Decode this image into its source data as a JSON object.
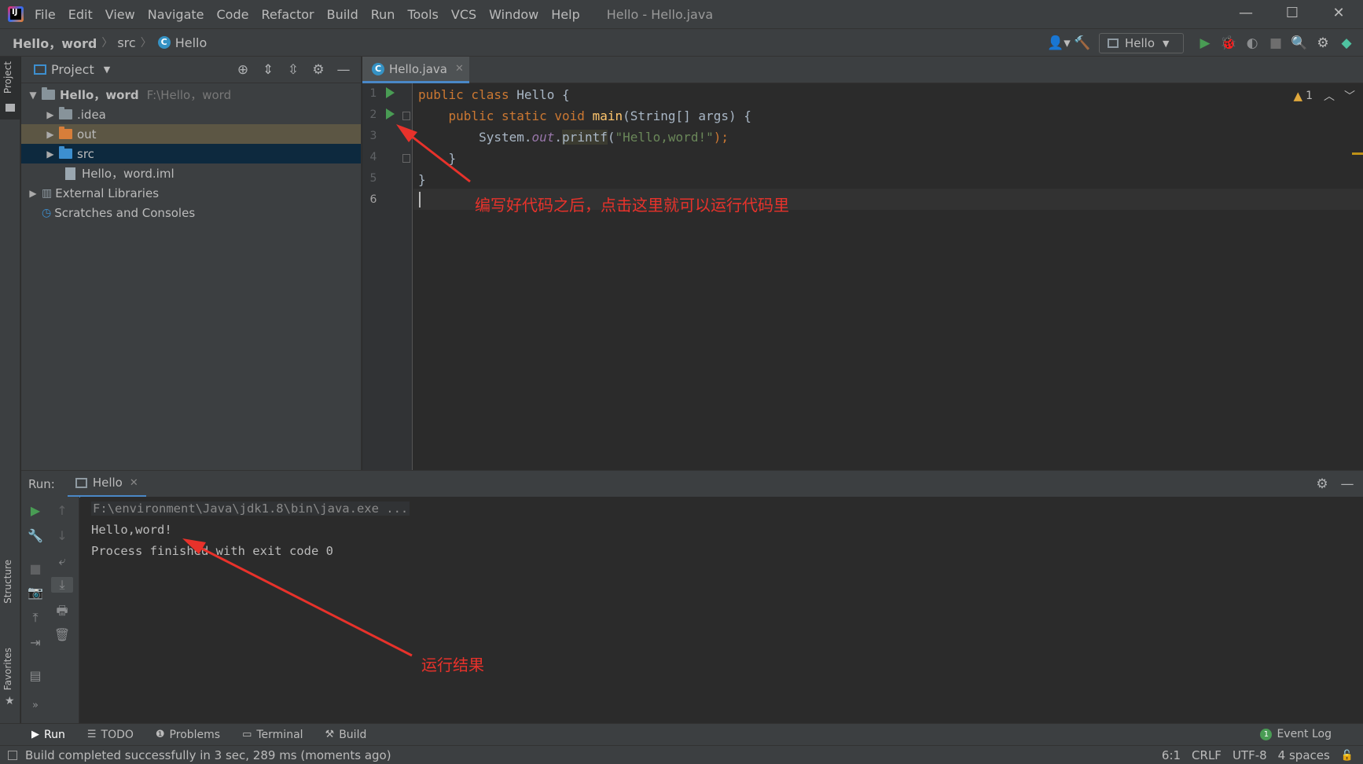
{
  "menubar": {
    "logo_text": "IJ",
    "items": [
      "File",
      "Edit",
      "View",
      "Navigate",
      "Code",
      "Refactor",
      "Build",
      "Run",
      "Tools",
      "VCS",
      "Window",
      "Help"
    ],
    "window_title": "Hello - Hello.java"
  },
  "window_controls": {
    "minimize": "—",
    "maximize": "☐",
    "close": "✕"
  },
  "navbar": {
    "breadcrumbs": [
      "Hello，word",
      "src",
      "Hello"
    ],
    "run_config": "Hello"
  },
  "left_strip": {
    "project_tab": "Project",
    "structure_tab": "Structure",
    "favorites_tab": "Favorites"
  },
  "project_panel": {
    "title": "Project",
    "tree": [
      {
        "label": "Hello，word",
        "path": "F:\\Hello，word"
      },
      {
        "label": ".idea"
      },
      {
        "label": "out"
      },
      {
        "label": "src"
      },
      {
        "label": "Hello，word.iml"
      },
      {
        "label": "External Libraries"
      },
      {
        "label": "Scratches and Consoles"
      }
    ]
  },
  "editor": {
    "tab_label": "Hello.java",
    "line_numbers": [
      "1",
      "2",
      "3",
      "4",
      "5",
      "6"
    ],
    "code": {
      "l1_kw": "public class ",
      "l1_rest": "Hello {",
      "l2_indent": "    ",
      "l2_kw": "public static void ",
      "l2_fn": "main",
      "l2_rest": "(String[] args) {",
      "l3_pre": "        System.",
      "l3_field": "out",
      "l3_dot": ".",
      "l3_method": "printf",
      "l3_open": "(",
      "l3_str": "\"Hello,word!\"",
      "l3_close": ");",
      "l4": "    }",
      "l5": "}"
    },
    "warning_count": "1",
    "annotation": "编写好代码之后，点击这里就可以运行代码里"
  },
  "run_panel": {
    "label": "Run:",
    "tab_label": "Hello",
    "console": [
      "F:\\environment\\Java\\jdk1.8\\bin\\java.exe ...",
      "Hello,word!",
      "Process finished with exit code 0"
    ],
    "annotation": "运行结果"
  },
  "bottom_tabs": [
    "Run",
    "TODO",
    "Problems",
    "Terminal",
    "Build"
  ],
  "event_log": {
    "badge": "1",
    "label": "Event Log"
  },
  "statusbar": {
    "message": "Build completed successfully in 3 sec, 289 ms (moments ago)",
    "position": "6:1",
    "line_sep": "CRLF",
    "encoding": "UTF-8",
    "indent": "4 spaces"
  },
  "colors": {
    "background": "#2b2b2b",
    "panel": "#3c3f41",
    "keyword": "#cc7832",
    "function": "#ffc66d",
    "string": "#6a8759",
    "run_green": "#499c54",
    "annotation_red": "#e8322b",
    "selection": "#0d293e"
  }
}
